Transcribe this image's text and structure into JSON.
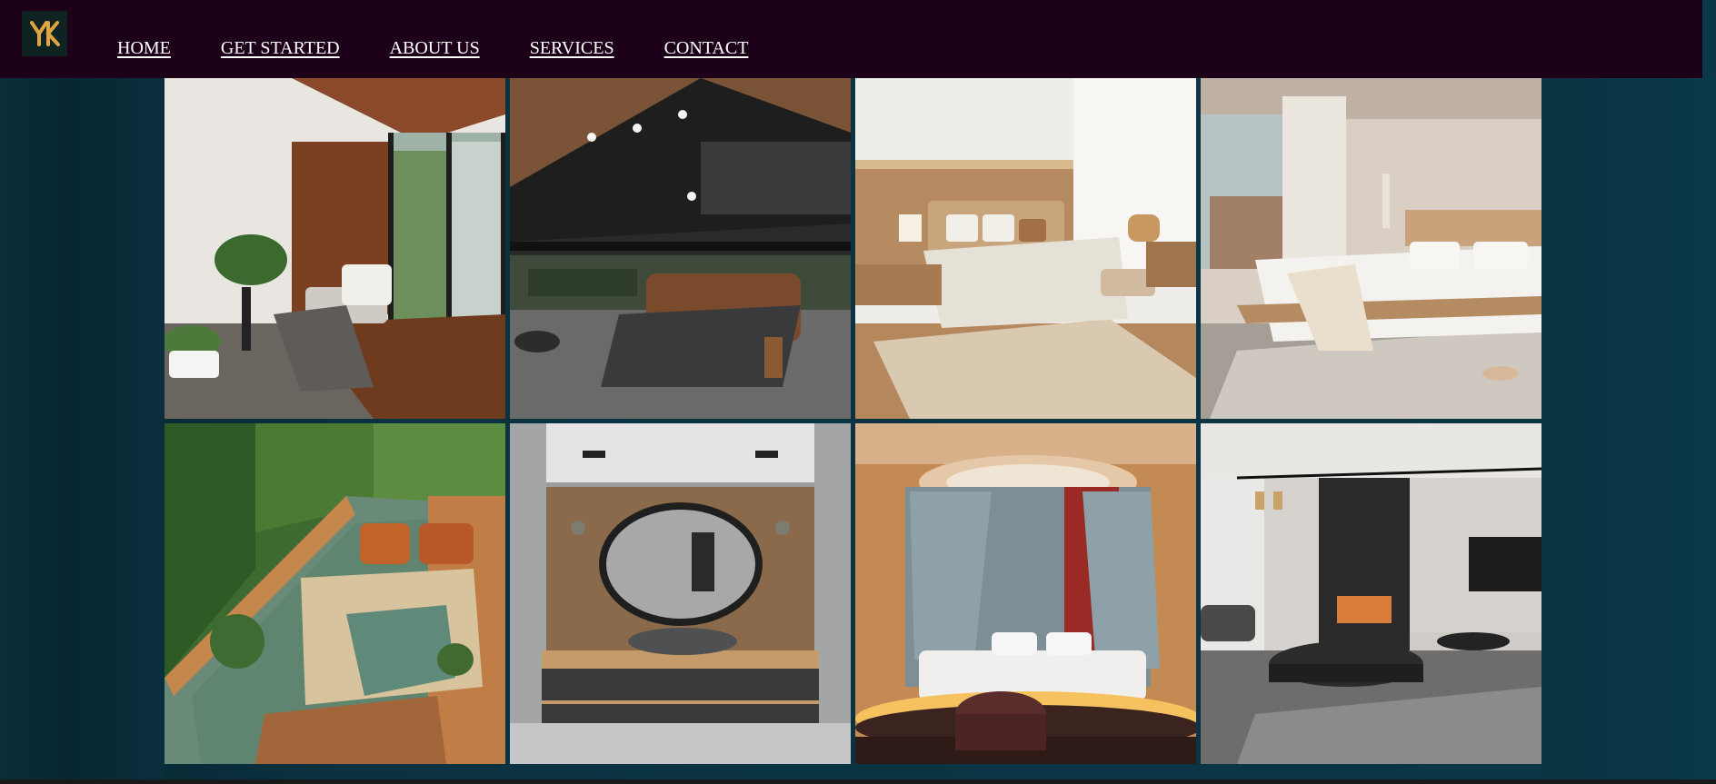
{
  "app": {
    "logo_text": "YK",
    "logo_icon": "yk-monogram-icon",
    "colors": {
      "navbar_bg": "#1c0119",
      "page_bg": "#0a3342",
      "logo_gold": "#e0a441"
    }
  },
  "nav": {
    "items": [
      {
        "label": "HOME"
      },
      {
        "label": "GET STARTED"
      },
      {
        "label": "ABOUT US"
      },
      {
        "label": "SERVICES"
      },
      {
        "label": "CONTACT"
      }
    ]
  },
  "gallery": {
    "tiles": [
      {
        "subject": "window-seat-wood-nook"
      },
      {
        "subject": "dark-loft-bedroom"
      },
      {
        "subject": "beige-bedroom-nightstand"
      },
      {
        "subject": "minimal-bedroom-platform-bed"
      },
      {
        "subject": "green-window-daybed"
      },
      {
        "subject": "bathroom-oval-mirror"
      },
      {
        "subject": "canopy-bed-round-alcove"
      },
      {
        "subject": "grey-living-room-fireplace"
      }
    ]
  }
}
